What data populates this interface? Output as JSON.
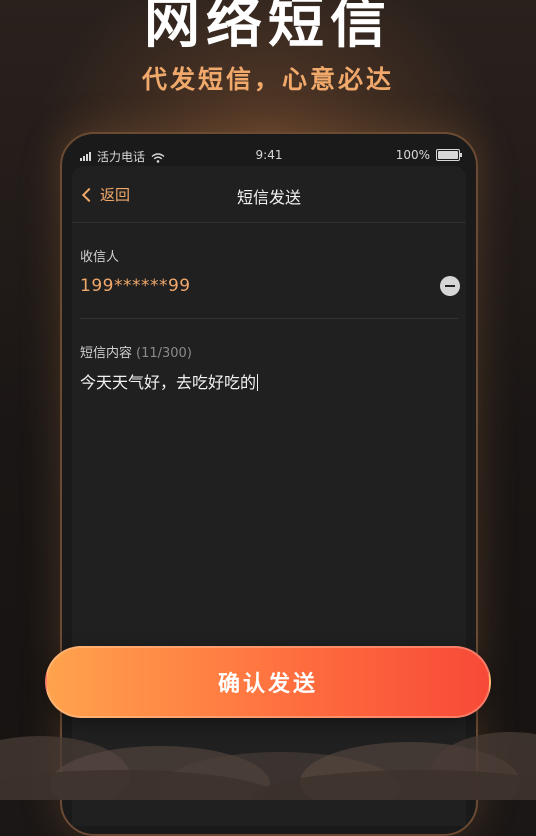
{
  "headline": "网络短信",
  "subheadline": "代发短信，心意必达",
  "status_bar": {
    "carrier": "活力电话",
    "time": "9:41",
    "battery": "100%"
  },
  "nav": {
    "back_label": "返回",
    "title": "短信发送"
  },
  "recipient": {
    "label": "收信人",
    "value": "199******99"
  },
  "message": {
    "label": "短信内容",
    "count": "(11/300)",
    "value": "今天天气好，去吃好吃的"
  },
  "send_button": {
    "label": "确认发送"
  },
  "colors": {
    "accent": "#f0a86b",
    "button_start": "#ffa34d",
    "button_end": "#f74a38",
    "screen_bg": "#202020"
  }
}
